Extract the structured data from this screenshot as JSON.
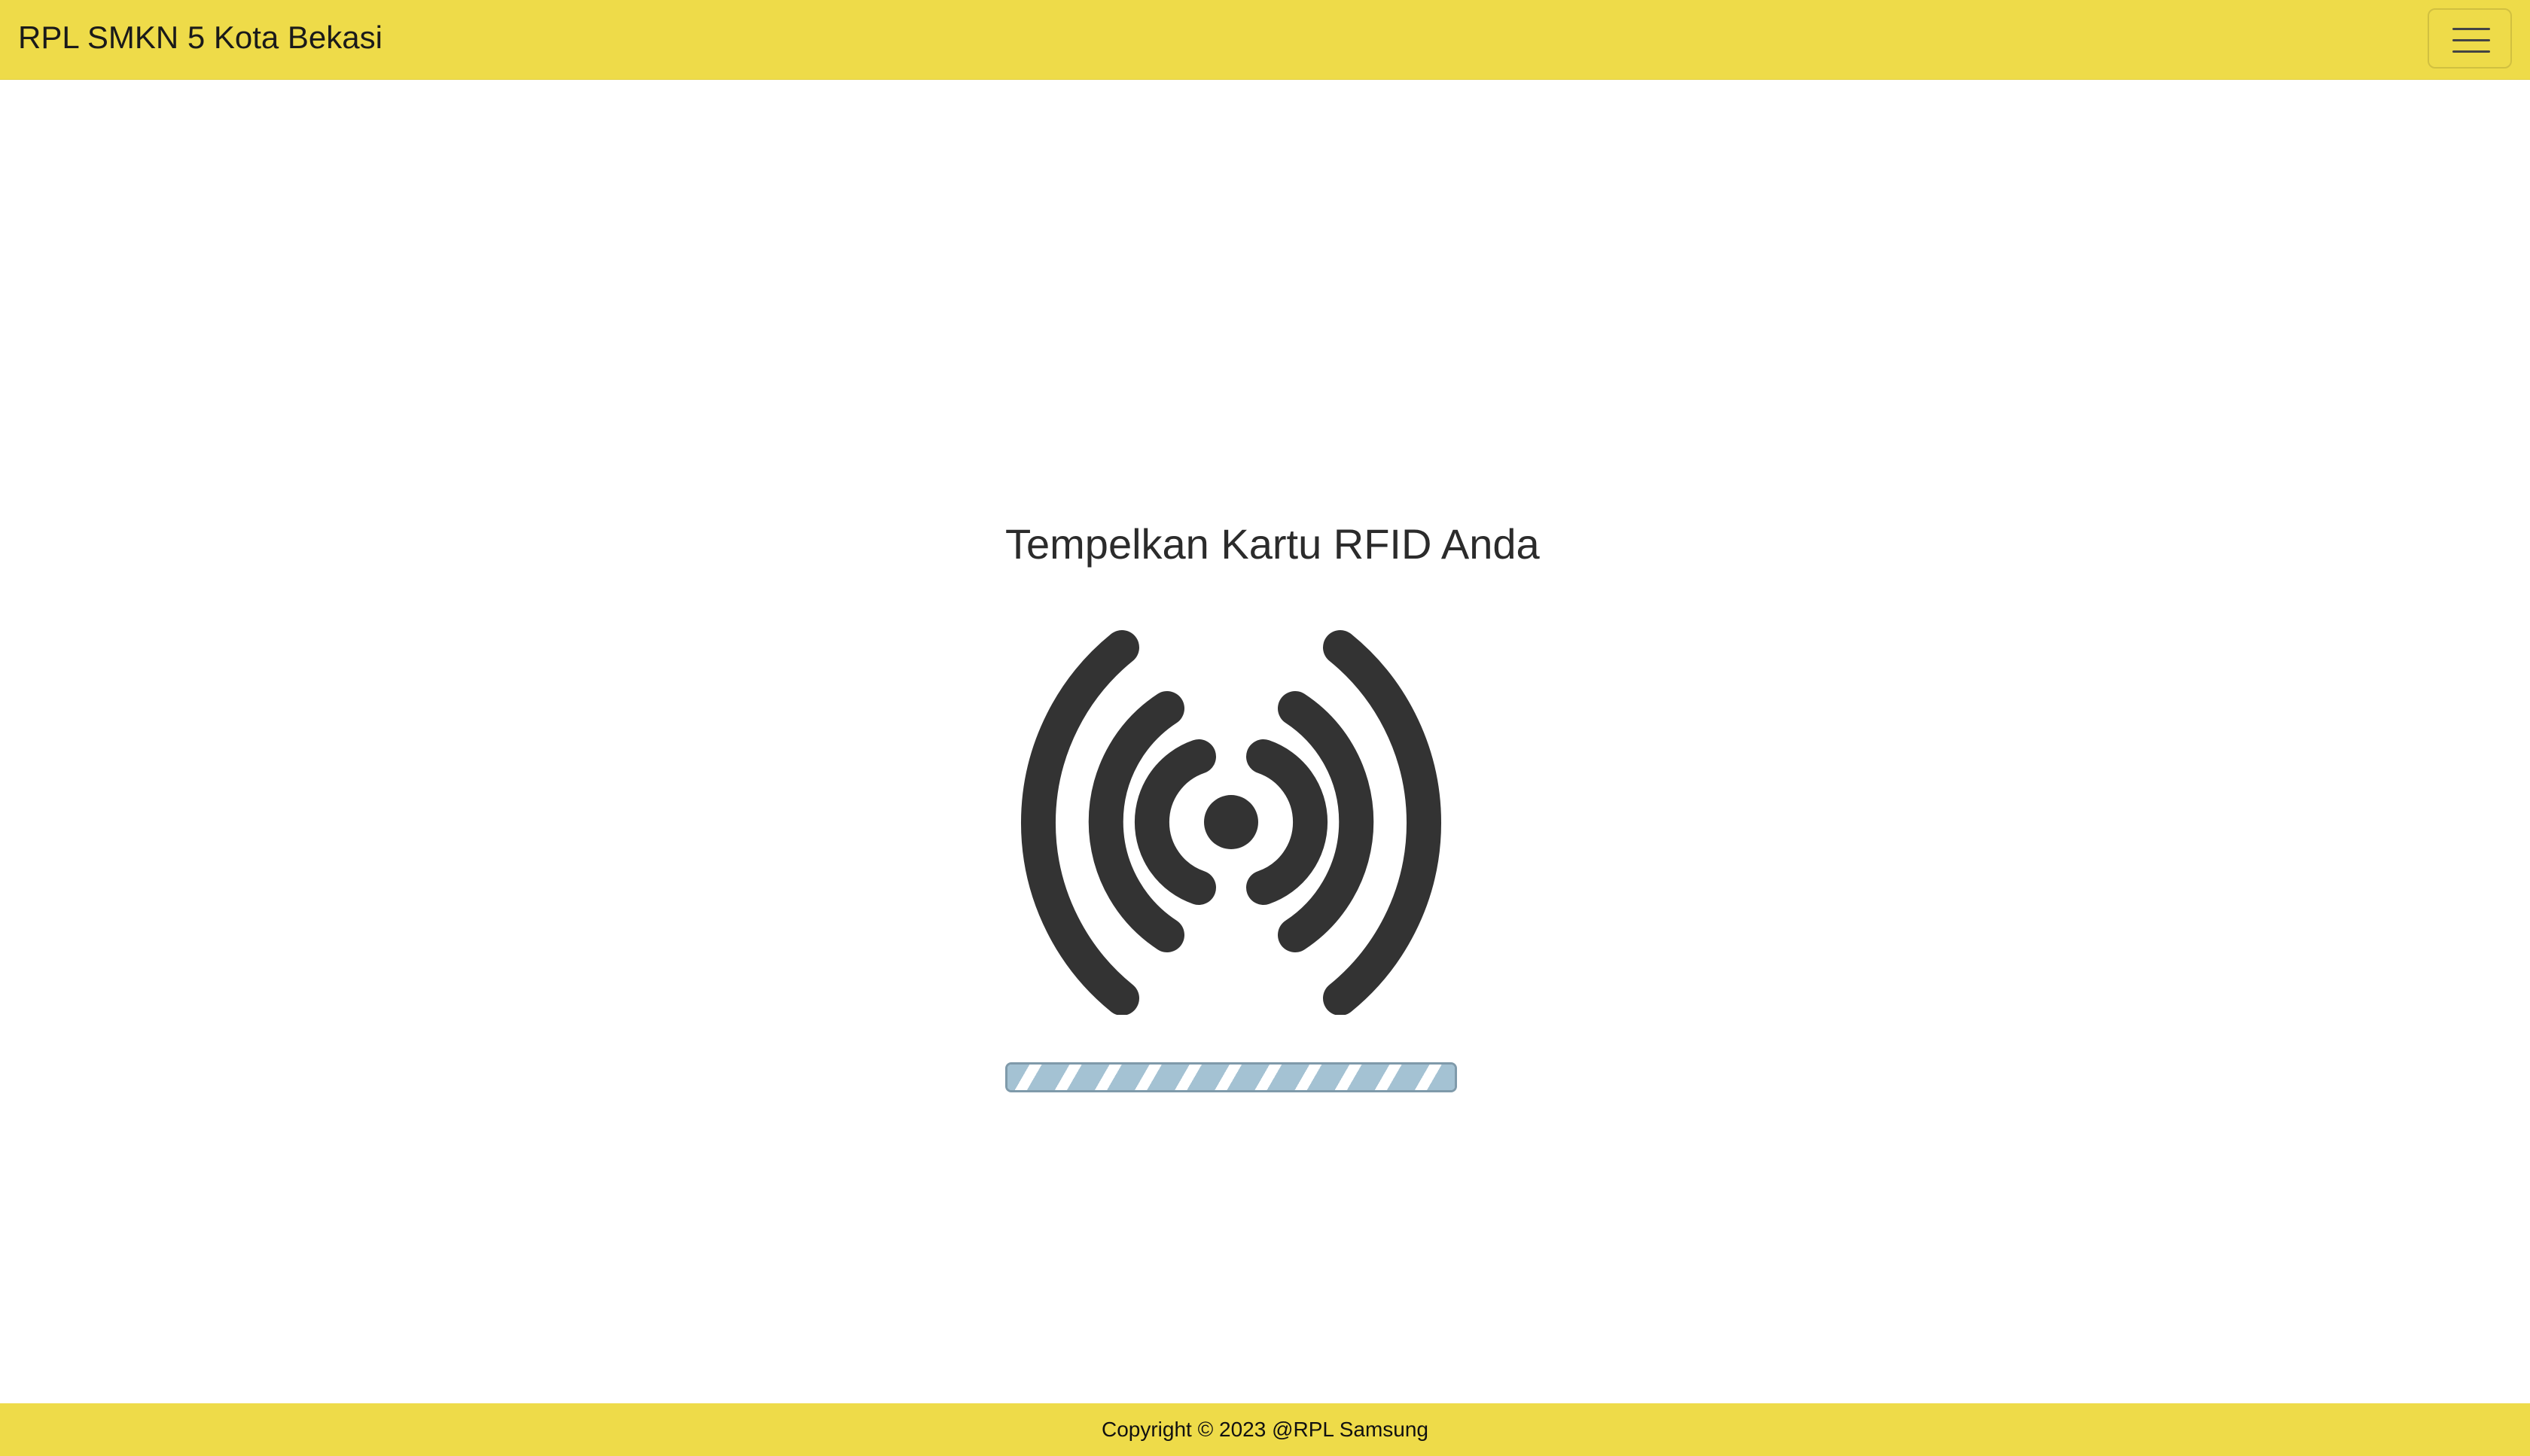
{
  "navbar": {
    "brand": "RPL SMKN 5 Kota Bekasi",
    "toggler_icon": "hamburger-menu-icon"
  },
  "main": {
    "title": "Tempelkan Kartu RFID Anda",
    "rfid_icon": "rfid-signal-icon",
    "progress": {
      "value_percent": 100,
      "style": "striped-animated"
    }
  },
  "footer": {
    "copyright": "Copyright © 2023 @RPL Samsung"
  },
  "colors": {
    "accent_yellow": "#eedb49",
    "icon_dark": "#333333",
    "progress_blue": "#a4c2d3"
  }
}
